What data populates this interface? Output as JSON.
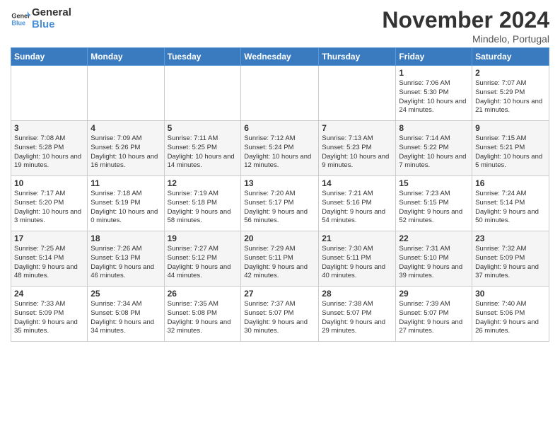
{
  "logo": {
    "text_general": "General",
    "text_blue": "Blue"
  },
  "header": {
    "month": "November 2024",
    "location": "Mindelo, Portugal"
  },
  "weekdays": [
    "Sunday",
    "Monday",
    "Tuesday",
    "Wednesday",
    "Thursday",
    "Friday",
    "Saturday"
  ],
  "weeks": [
    [
      {
        "day": "",
        "info": ""
      },
      {
        "day": "",
        "info": ""
      },
      {
        "day": "",
        "info": ""
      },
      {
        "day": "",
        "info": ""
      },
      {
        "day": "",
        "info": ""
      },
      {
        "day": "1",
        "info": "Sunrise: 7:06 AM\nSunset: 5:30 PM\nDaylight: 10 hours and 24 minutes."
      },
      {
        "day": "2",
        "info": "Sunrise: 7:07 AM\nSunset: 5:29 PM\nDaylight: 10 hours and 21 minutes."
      }
    ],
    [
      {
        "day": "3",
        "info": "Sunrise: 7:08 AM\nSunset: 5:28 PM\nDaylight: 10 hours and 19 minutes."
      },
      {
        "day": "4",
        "info": "Sunrise: 7:09 AM\nSunset: 5:26 PM\nDaylight: 10 hours and 16 minutes."
      },
      {
        "day": "5",
        "info": "Sunrise: 7:11 AM\nSunset: 5:25 PM\nDaylight: 10 hours and 14 minutes."
      },
      {
        "day": "6",
        "info": "Sunrise: 7:12 AM\nSunset: 5:24 PM\nDaylight: 10 hours and 12 minutes."
      },
      {
        "day": "7",
        "info": "Sunrise: 7:13 AM\nSunset: 5:23 PM\nDaylight: 10 hours and 9 minutes."
      },
      {
        "day": "8",
        "info": "Sunrise: 7:14 AM\nSunset: 5:22 PM\nDaylight: 10 hours and 7 minutes."
      },
      {
        "day": "9",
        "info": "Sunrise: 7:15 AM\nSunset: 5:21 PM\nDaylight: 10 hours and 5 minutes."
      }
    ],
    [
      {
        "day": "10",
        "info": "Sunrise: 7:17 AM\nSunset: 5:20 PM\nDaylight: 10 hours and 3 minutes."
      },
      {
        "day": "11",
        "info": "Sunrise: 7:18 AM\nSunset: 5:19 PM\nDaylight: 10 hours and 0 minutes."
      },
      {
        "day": "12",
        "info": "Sunrise: 7:19 AM\nSunset: 5:18 PM\nDaylight: 9 hours and 58 minutes."
      },
      {
        "day": "13",
        "info": "Sunrise: 7:20 AM\nSunset: 5:17 PM\nDaylight: 9 hours and 56 minutes."
      },
      {
        "day": "14",
        "info": "Sunrise: 7:21 AM\nSunset: 5:16 PM\nDaylight: 9 hours and 54 minutes."
      },
      {
        "day": "15",
        "info": "Sunrise: 7:23 AM\nSunset: 5:15 PM\nDaylight: 9 hours and 52 minutes."
      },
      {
        "day": "16",
        "info": "Sunrise: 7:24 AM\nSunset: 5:14 PM\nDaylight: 9 hours and 50 minutes."
      }
    ],
    [
      {
        "day": "17",
        "info": "Sunrise: 7:25 AM\nSunset: 5:14 PM\nDaylight: 9 hours and 48 minutes."
      },
      {
        "day": "18",
        "info": "Sunrise: 7:26 AM\nSunset: 5:13 PM\nDaylight: 9 hours and 46 minutes."
      },
      {
        "day": "19",
        "info": "Sunrise: 7:27 AM\nSunset: 5:12 PM\nDaylight: 9 hours and 44 minutes."
      },
      {
        "day": "20",
        "info": "Sunrise: 7:29 AM\nSunset: 5:11 PM\nDaylight: 9 hours and 42 minutes."
      },
      {
        "day": "21",
        "info": "Sunrise: 7:30 AM\nSunset: 5:11 PM\nDaylight: 9 hours and 40 minutes."
      },
      {
        "day": "22",
        "info": "Sunrise: 7:31 AM\nSunset: 5:10 PM\nDaylight: 9 hours and 39 minutes."
      },
      {
        "day": "23",
        "info": "Sunrise: 7:32 AM\nSunset: 5:09 PM\nDaylight: 9 hours and 37 minutes."
      }
    ],
    [
      {
        "day": "24",
        "info": "Sunrise: 7:33 AM\nSunset: 5:09 PM\nDaylight: 9 hours and 35 minutes."
      },
      {
        "day": "25",
        "info": "Sunrise: 7:34 AM\nSunset: 5:08 PM\nDaylight: 9 hours and 34 minutes."
      },
      {
        "day": "26",
        "info": "Sunrise: 7:35 AM\nSunset: 5:08 PM\nDaylight: 9 hours and 32 minutes."
      },
      {
        "day": "27",
        "info": "Sunrise: 7:37 AM\nSunset: 5:07 PM\nDaylight: 9 hours and 30 minutes."
      },
      {
        "day": "28",
        "info": "Sunrise: 7:38 AM\nSunset: 5:07 PM\nDaylight: 9 hours and 29 minutes."
      },
      {
        "day": "29",
        "info": "Sunrise: 7:39 AM\nSunset: 5:07 PM\nDaylight: 9 hours and 27 minutes."
      },
      {
        "day": "30",
        "info": "Sunrise: 7:40 AM\nSunset: 5:06 PM\nDaylight: 9 hours and 26 minutes."
      }
    ]
  ]
}
